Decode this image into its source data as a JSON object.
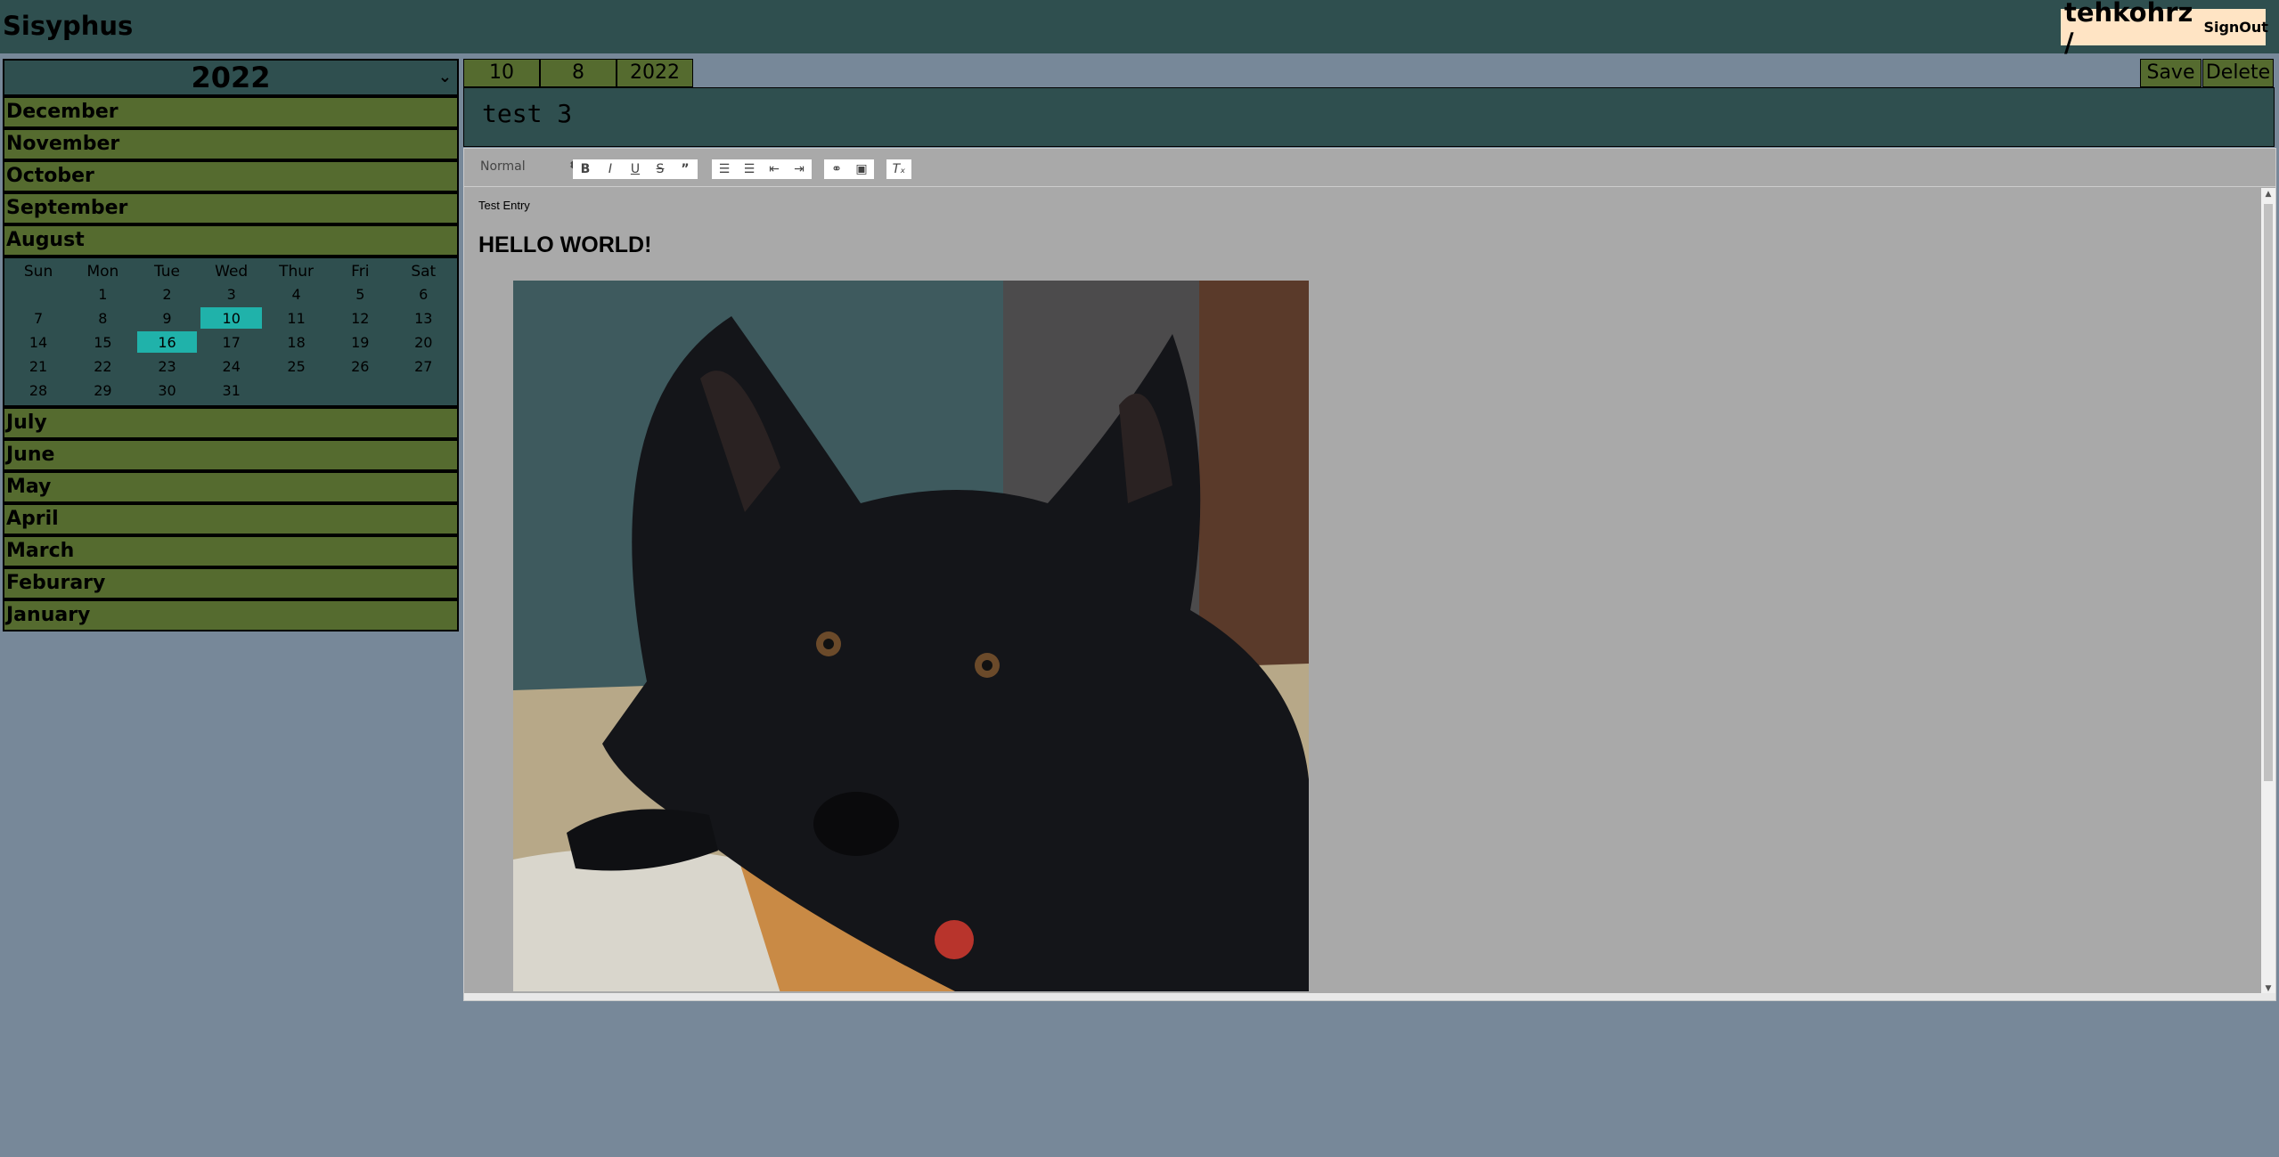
{
  "app": {
    "title": "Sisyphus"
  },
  "user": {
    "name": "tehkohrz /",
    "signout_label": "SignOut"
  },
  "sidebar": {
    "year": "2022",
    "months_before": [
      "December",
      "November",
      "October",
      "September",
      "August"
    ],
    "months_after": [
      "July",
      "June",
      "May",
      "April",
      "March",
      "Feburary",
      "January"
    ],
    "calendar": {
      "weekdays": [
        "Sun",
        "Mon",
        "Tue",
        "Wed",
        "Thur",
        "Fri",
        "Sat"
      ],
      "weeks": [
        [
          "",
          "1",
          "2",
          "3",
          "4",
          "5",
          "6"
        ],
        [
          "7",
          "8",
          "9",
          "10",
          "11",
          "12",
          "13"
        ],
        [
          "14",
          "15",
          "16",
          "17",
          "18",
          "19",
          "20"
        ],
        [
          "21",
          "22",
          "23",
          "24",
          "25",
          "26",
          "27"
        ],
        [
          "28",
          "29",
          "30",
          "31",
          "",
          "",
          ""
        ]
      ],
      "highlighted": [
        "10",
        "16"
      ]
    }
  },
  "entry": {
    "day": "10",
    "month": "8",
    "year": "2022",
    "save_label": "Save",
    "delete_label": "Delete",
    "title": "test 3",
    "format_label": "Normal",
    "body_small": "Test Entry",
    "body_heading": "HELLO WORLD!"
  },
  "colors": {
    "page_bg": "#778899",
    "header_bg": "#2f4f4f",
    "month_bg": "#556b2f",
    "highlight": "#20b2aa",
    "user_bg": "#ffe4c4",
    "editor_bg": "#a9a9a9"
  }
}
